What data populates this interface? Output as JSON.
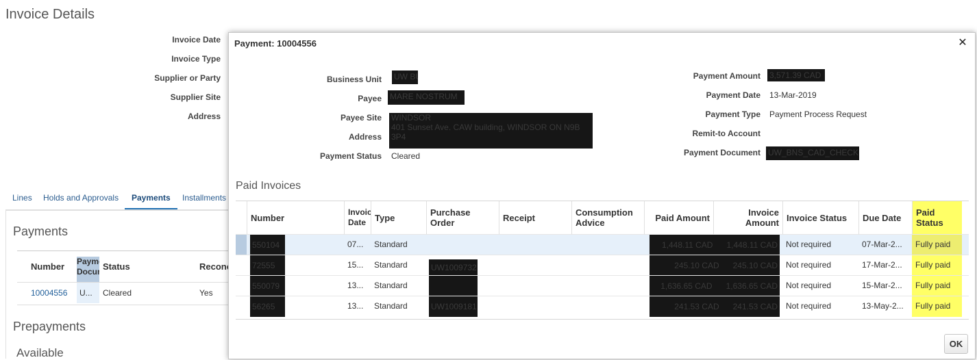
{
  "page": {
    "title": "Invoice Details",
    "labels": [
      "Invoice Date",
      "Invoice Type",
      "Supplier or Party",
      "Supplier Site",
      "Address"
    ],
    "tabs": [
      "Lines",
      "Holds and Approvals",
      "Payments",
      "Installments"
    ],
    "active_tab": "Payments",
    "payments_heading": "Payments",
    "payments_table": {
      "columns": [
        "Number",
        "Payment Document",
        "Status",
        "Reconc"
      ],
      "row": {
        "number": "10004556",
        "document": "U...",
        "status": "Cleared",
        "reconciled": "Yes"
      }
    },
    "prepayments_heading": "Prepayments",
    "available_heading": "Available"
  },
  "dialog": {
    "title": "Payment: 10004556",
    "close_icon": "✕",
    "left_fields": {
      "business_unit": {
        "label": "Business Unit",
        "value": "UW BU"
      },
      "payee": {
        "label": "Payee",
        "value": "MARE NOSTRUM"
      },
      "payee_site": {
        "label": "Payee Site",
        "value": "WINDSOR"
      },
      "address": {
        "label": "Address",
        "value": "401 Sunset Ave. CAW building, WINDSOR ON N9B 3P4"
      },
      "payment_status": {
        "label": "Payment Status",
        "value": "Cleared"
      }
    },
    "right_fields": {
      "payment_amount": {
        "label": "Payment Amount",
        "value": "3,571.39 CAD"
      },
      "payment_date": {
        "label": "Payment Date",
        "value": "13-Mar-2019"
      },
      "payment_type": {
        "label": "Payment Type",
        "value": "Payment Process Request"
      },
      "remit_to": {
        "label": "Remit-to Account",
        "value": ""
      },
      "payment_document": {
        "label": "Payment Document",
        "value": "UW_BNS_CAD_CHECK"
      }
    },
    "paid_invoices_heading": "Paid Invoices",
    "grid": {
      "headers": {
        "number": "Number",
        "invoice_date": "Invoice Date",
        "type": "Type",
        "purchase_order": "Purchase Order",
        "receipt": "Receipt",
        "consumption_advice": "Consumption Advice",
        "paid_amount": "Paid Amount",
        "invoice_amount": "Invoice Amount",
        "invoice_status": "Invoice Status",
        "due_date": "Due Date",
        "paid_status": "Paid Status"
      },
      "rows": [
        {
          "number": "550104",
          "date": "07...",
          "type": "Standard",
          "po": "",
          "paid": "1,448.11 CAD",
          "inv_amt": "1,448.11 CAD",
          "status": "Not required",
          "due": "07-Mar-2...",
          "paid_status": "Fully paid"
        },
        {
          "number": "72555",
          "date": "15...",
          "type": "Standard",
          "po": "UW1009732",
          "paid": "245.10 CAD",
          "inv_amt": "245.10 CAD",
          "status": "Not required",
          "due": "17-Mar-2...",
          "paid_status": "Fully paid"
        },
        {
          "number": "550079",
          "date": "13...",
          "type": "Standard",
          "po": "",
          "paid": "1,636.65 CAD",
          "inv_amt": "1,636.65 CAD",
          "status": "Not required",
          "due": "15-Mar-2...",
          "paid_status": "Fully paid"
        },
        {
          "number": "56265",
          "date": "13...",
          "type": "Standard",
          "po": "UW1009181",
          "paid": "241.53 CAD",
          "inv_amt": "241.53 CAD",
          "status": "Not required",
          "due": "13-May-2...",
          "paid_status": "Fully paid"
        }
      ]
    },
    "ok_label": "OK"
  },
  "colors": {
    "highlight": "#ffff66",
    "link": "#2a5c8f",
    "selected_row": "#e6f0fa"
  }
}
